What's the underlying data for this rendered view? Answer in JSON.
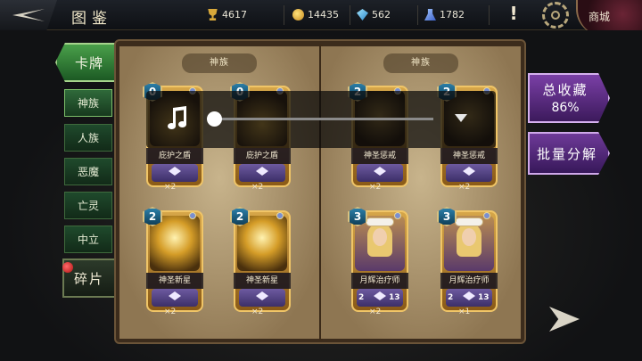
{
  "header": {
    "title": "图鉴",
    "resources": [
      {
        "icon": "trophy-icon",
        "value": "4617"
      },
      {
        "icon": "coin-icon",
        "value": "14435"
      },
      {
        "icon": "gem-icon",
        "value": "562"
      },
      {
        "icon": "dust-icon",
        "value": "1782"
      }
    ],
    "alert_icon": "!",
    "shop_label": "商城"
  },
  "nav": {
    "main_label": "卡牌",
    "items": [
      "神族",
      "人族",
      "恶魔",
      "亡灵",
      "中立"
    ],
    "active_index": 0,
    "fragment_label": "碎片"
  },
  "book": {
    "left_page_title": "神族",
    "right_page_title": "神族"
  },
  "cards": [
    {
      "name": "庇护之盾",
      "cost": "0",
      "count": "×2",
      "art": "shield",
      "attack": "",
      "health": ""
    },
    {
      "name": "庇护之盾",
      "cost": "0",
      "count": "×2",
      "art": "shield",
      "attack": "",
      "health": ""
    },
    {
      "name": "神圣惩戒",
      "cost": "2",
      "count": "×2",
      "art": "dark",
      "attack": "",
      "health": ""
    },
    {
      "name": "神圣惩戒",
      "cost": "2",
      "count": "×2",
      "art": "dark",
      "attack": "",
      "health": ""
    },
    {
      "name": "神圣新星",
      "cost": "2",
      "count": "×2",
      "art": "gold",
      "attack": "",
      "health": ""
    },
    {
      "name": "神圣新星",
      "cost": "2",
      "count": "×2",
      "art": "gold",
      "attack": "",
      "health": ""
    },
    {
      "name": "月辉治疗师",
      "cost": "3",
      "count": "×2",
      "art": "healer",
      "attack": "2",
      "health": "13"
    },
    {
      "name": "月辉治疗师",
      "cost": "3",
      "count": "×1",
      "art": "healer",
      "attack": "2",
      "health": "13"
    }
  ],
  "side": {
    "collection_label": "总收藏",
    "collection_percent": "86%",
    "disenchant_label": "批量分解"
  },
  "music_player": {
    "icon": "music-note-icon",
    "progress": 0.0
  }
}
